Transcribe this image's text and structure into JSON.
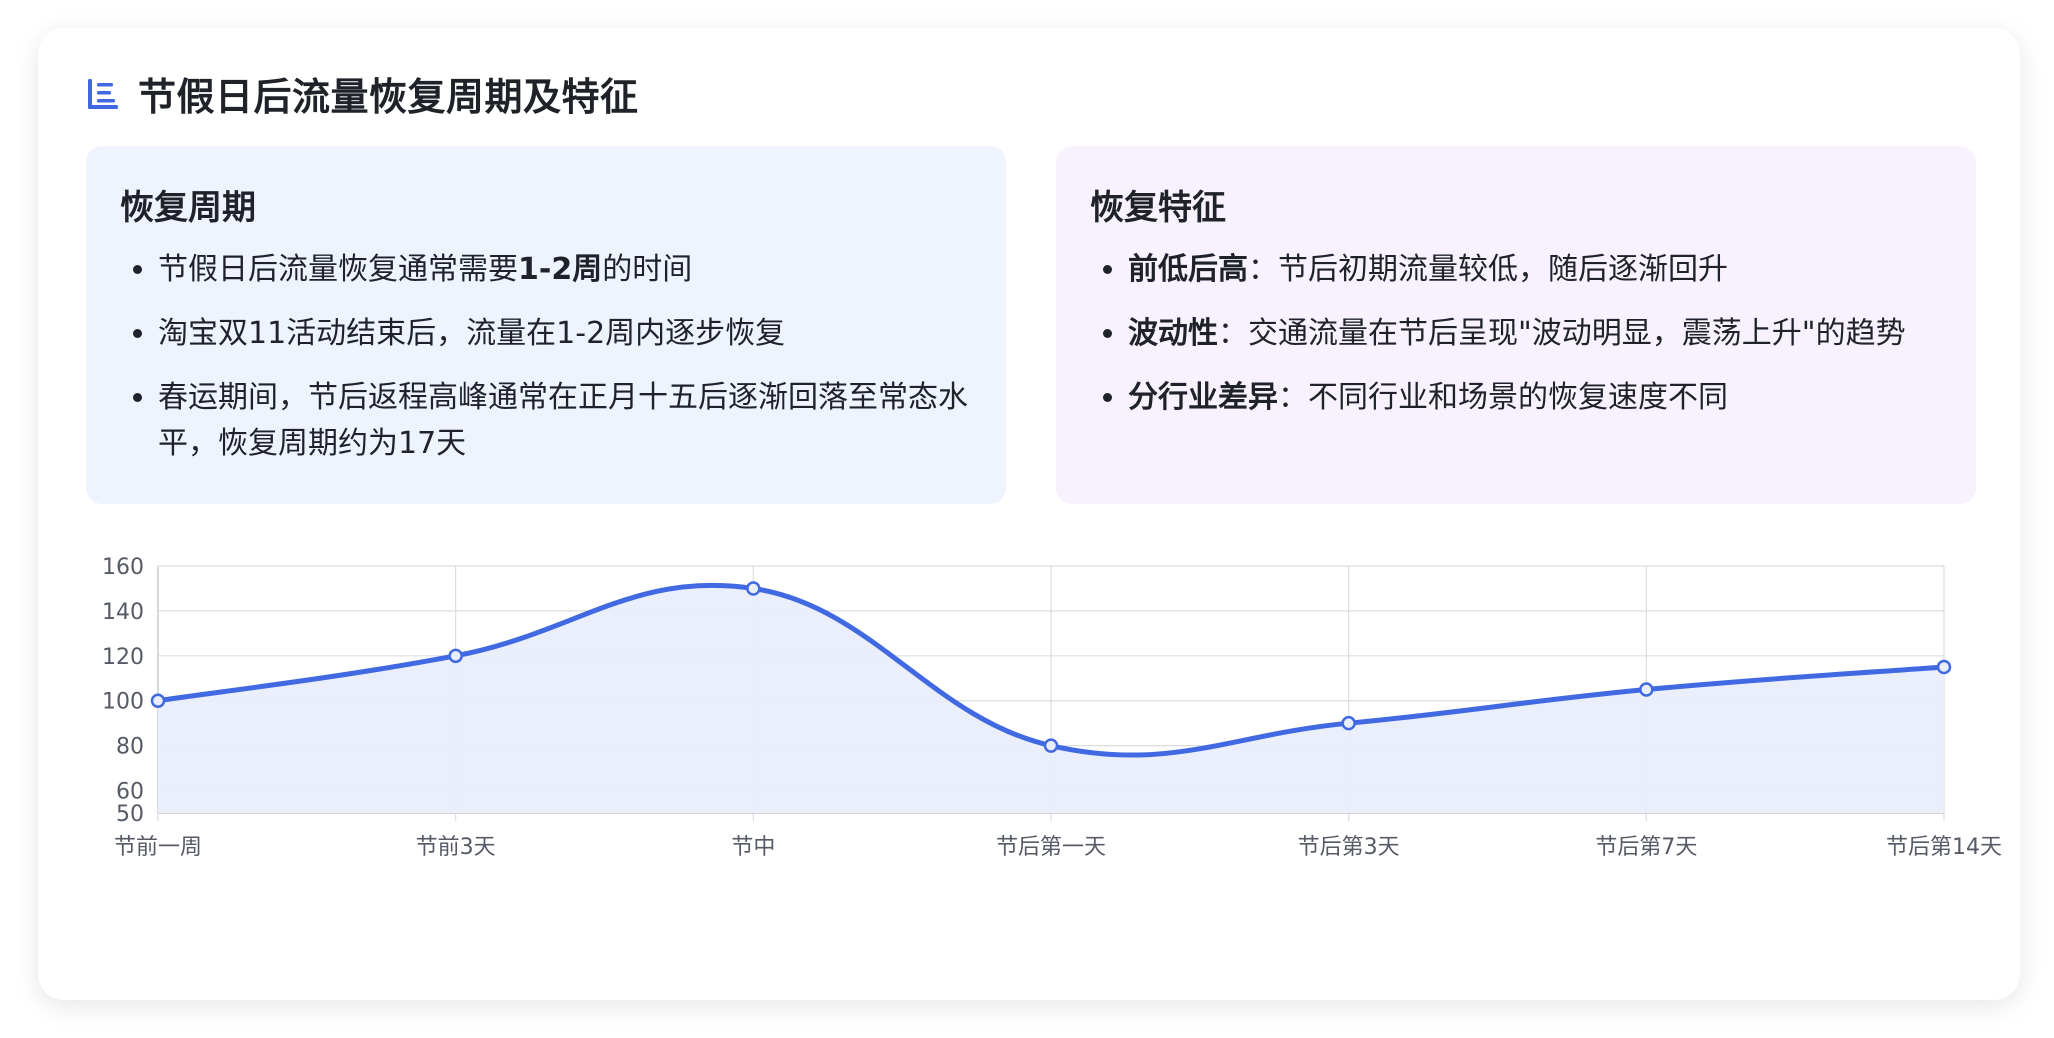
{
  "header": {
    "title": "节假日后流量恢复周期及特征",
    "icon": "list-icon"
  },
  "panels": {
    "cycle": {
      "title": "恢复周期",
      "items": [
        {
          "pre": "节假日后流量恢复通常需要",
          "bold": "1-2周",
          "post": "的时间"
        },
        {
          "pre": "淘宝双11活动结束后，流量在1-2周内逐步恢复",
          "bold": "",
          "post": ""
        },
        {
          "pre": "春运期间，节后返程高峰通常在正月十五后逐渐回落至常态水平，恢复周期约为17天",
          "bold": "",
          "post": ""
        }
      ]
    },
    "features": {
      "title": "恢复特征",
      "items": [
        {
          "bold": "前低后高",
          "post": "：节后初期流量较低，随后逐渐回升"
        },
        {
          "bold": "波动性",
          "post": "：交通流量在节后呈现\"波动明显，震荡上升\"的趋势"
        },
        {
          "bold": "分行业差异",
          "post": "：不同行业和场景的恢复速度不同"
        }
      ]
    }
  },
  "colors": {
    "accent": "#4169e1",
    "fill": "#e9eefb",
    "grid": "#dcdde0",
    "panel_left": "#eef3fe",
    "panel_right": "#f7f2fd"
  },
  "chart_data": {
    "type": "line",
    "categories": [
      "节前一周",
      "节前3天",
      "节中",
      "节后第一天",
      "节后第3天",
      "节后第7天",
      "节后第14天"
    ],
    "series": [
      {
        "values": [
          100,
          120,
          150,
          80,
          90,
          105,
          115
        ]
      }
    ],
    "yticks": [
      50,
      60,
      80,
      100,
      120,
      140,
      160
    ],
    "ylim": [
      50,
      160
    ],
    "grid": true,
    "smooth": true,
    "area_fill": true,
    "legend": "none",
    "title": "",
    "xlabel": "",
    "ylabel": ""
  }
}
